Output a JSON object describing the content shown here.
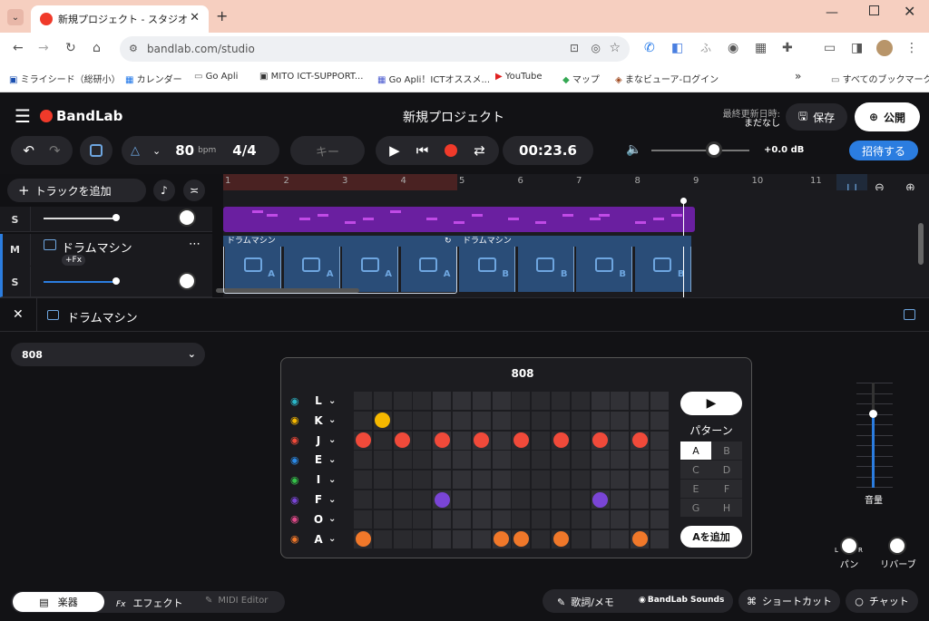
{
  "browser": {
    "tab_title": "新規プロジェクト - スタジオ",
    "url": "bandlab.com/studio",
    "bookmarks": [
      "ミライシード（総研小）",
      "カレンダー",
      "Go Apli",
      "MITO ICT-SUPPORT...",
      "Go Apli！ICTオススメ...",
      "YouTube",
      "マップ",
      "まなビューア-ログイン"
    ],
    "all_bookmarks": "すべてのブックマーク"
  },
  "app": {
    "logo": "BandLab",
    "project_title": "新規プロジェクト",
    "last_updated_label": "最終更新日時:",
    "last_updated_value": "まだなし",
    "save": "保存",
    "publish": "公開",
    "bpm": "80",
    "bpm_unit": "bpm",
    "time_sig": "4/4",
    "key": "キー",
    "time": "00:23.6",
    "volume": "+0.0 dB",
    "invite": "招待する",
    "add_track": "トラックを追加"
  },
  "ruler": [
    "1",
    "2",
    "3",
    "4",
    "5",
    "6",
    "7",
    "8",
    "9",
    "10",
    "11"
  ],
  "tracks": [
    {
      "solo": "S",
      "mute": "M",
      "name": "ドラムマシン",
      "fx": "+Fx"
    }
  ],
  "clips": [
    {
      "name": "ドラムマシン",
      "label": "A"
    },
    {
      "name": "ドラムマシン",
      "label": "B"
    }
  ],
  "panel": {
    "title": "ドラムマシン",
    "kit": "808",
    "machine_title": "808",
    "pattern_label": "パターン",
    "patterns": [
      "A",
      "B",
      "C",
      "D",
      "E",
      "F",
      "G",
      "H"
    ],
    "add_pattern": "Aを追加",
    "volume_label": "音量",
    "pan_label": "パン",
    "reverb_label": "リバーブ",
    "pan_l": "L",
    "pan_r": "R"
  },
  "drum_rows": [
    {
      "key": "L",
      "color": "#2bb6c8",
      "icon": "cymbal-icon",
      "steps": []
    },
    {
      "key": "K",
      "color": "#f5b800",
      "icon": "cowbell-icon",
      "steps": [
        1
      ]
    },
    {
      "key": "J",
      "color": "#f04a3a",
      "icon": "hihat-icon",
      "steps": [
        0,
        2,
        4,
        6,
        8,
        10,
        12,
        14
      ]
    },
    {
      "key": "E",
      "color": "#2b8ae6",
      "icon": "tom-icon",
      "steps": []
    },
    {
      "key": "I",
      "color": "#35c24a",
      "icon": "tom-icon",
      "steps": []
    },
    {
      "key": "F",
      "color": "#7a45d6",
      "icon": "snare-icon",
      "steps": [
        4,
        12
      ]
    },
    {
      "key": "O",
      "color": "#e04a8a",
      "icon": "tom-icon",
      "steps": []
    },
    {
      "key": "A",
      "color": "#f0782a",
      "icon": "kick-icon",
      "steps": [
        0,
        7,
        8,
        10,
        14
      ]
    }
  ],
  "bottom": {
    "instrument": "楽器",
    "effects": "エフェクト",
    "midi": "MIDI Editor",
    "lyrics": "歌詞/メモ",
    "sounds": "BandLab Sounds",
    "shortcuts": "ショートカット",
    "chat": "チャット"
  }
}
